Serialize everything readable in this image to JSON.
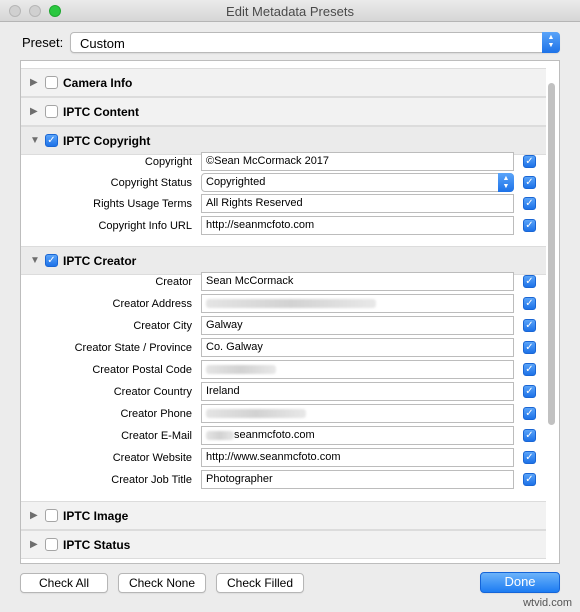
{
  "window": {
    "title": "Edit Metadata Presets"
  },
  "preset": {
    "label": "Preset:",
    "value": "Custom"
  },
  "sections": [
    {
      "title": "Camera Info",
      "checked": false,
      "expanded": false
    },
    {
      "title": "IPTC Content",
      "checked": false,
      "expanded": false
    },
    {
      "title": "IPTC Copyright",
      "checked": true,
      "expanded": true,
      "fields": [
        {
          "label": "Copyright",
          "value": "©Sean McCormack 2017",
          "checked": true
        },
        {
          "label": "Copyright Status",
          "value": "Copyrighted",
          "checked": true,
          "type": "select"
        },
        {
          "label": "Rights Usage Terms",
          "value": "All Rights Reserved",
          "checked": true
        },
        {
          "label": "Copyright Info URL",
          "value": "http://seanmcfoto.com",
          "checked": true
        }
      ]
    },
    {
      "title": "IPTC Creator",
      "checked": true,
      "expanded": true,
      "fields": [
        {
          "label": "Creator",
          "value": "Sean McCormack",
          "checked": true
        },
        {
          "label": "Creator Address",
          "value": "",
          "blurred": true,
          "checked": true
        },
        {
          "label": "Creator City",
          "value": "Galway",
          "checked": true
        },
        {
          "label": "Creator State / Province",
          "value": "Co. Galway",
          "checked": true
        },
        {
          "label": "Creator Postal Code",
          "value": "",
          "blurred": true,
          "checked": true
        },
        {
          "label": "Creator Country",
          "value": "Ireland",
          "checked": true
        },
        {
          "label": "Creator Phone",
          "value": "",
          "blurred": true,
          "checked": true
        },
        {
          "label": "Creator E-Mail",
          "value": "seanmcfoto.com",
          "partial_blur": true,
          "checked": true
        },
        {
          "label": "Creator Website",
          "value": "http://www.seanmcfoto.com",
          "checked": true
        },
        {
          "label": "Creator Job Title",
          "value": "Photographer",
          "checked": true
        }
      ]
    },
    {
      "title": "IPTC Image",
      "checked": false,
      "expanded": false
    },
    {
      "title": "IPTC Status",
      "checked": false,
      "expanded": false
    }
  ],
  "buttons": {
    "check_all": "Check All",
    "check_none": "Check None",
    "check_filled": "Check Filled",
    "done": "Done"
  },
  "watermark": "wtvid.com",
  "colors": {
    "accent": "#1d7cf2",
    "zoom": "#2bc840"
  }
}
